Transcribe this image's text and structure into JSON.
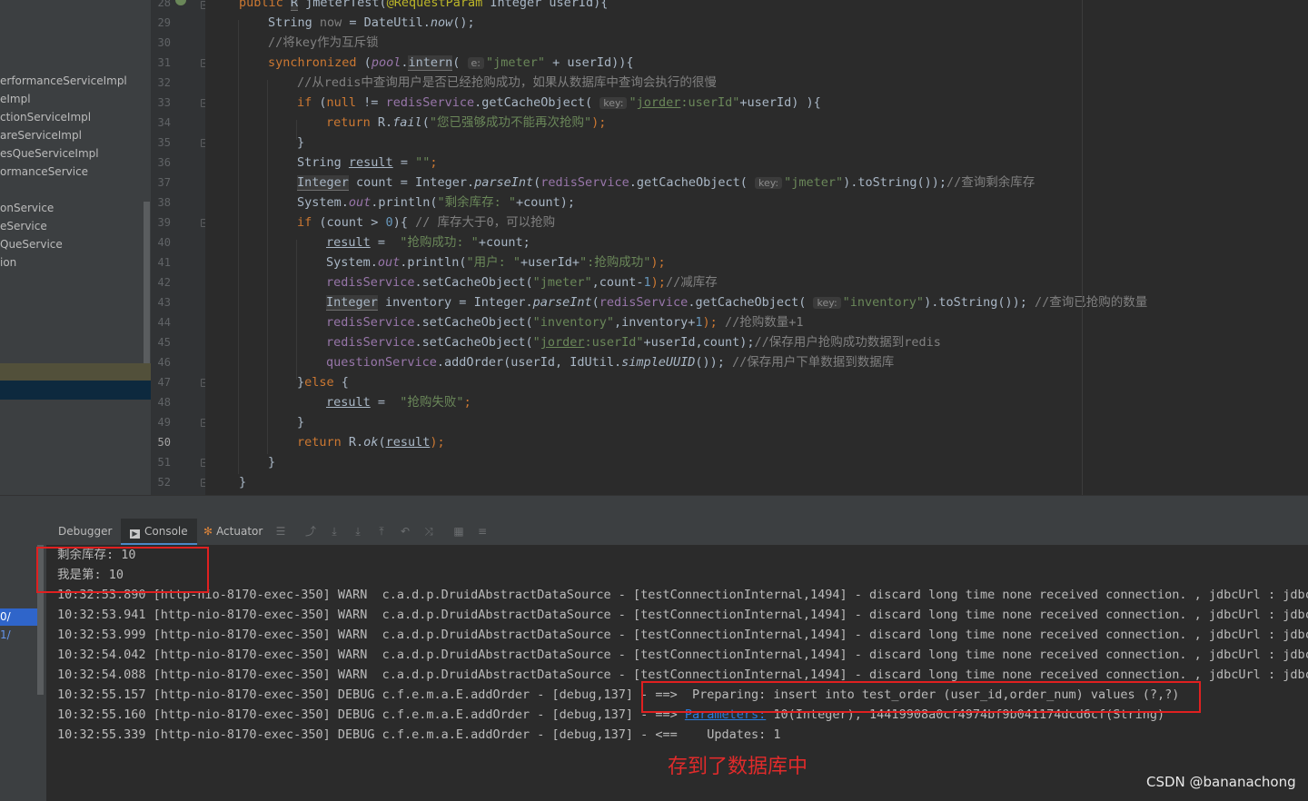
{
  "sidebar": {
    "items": [
      "erformanceServiceImpl",
      "eImpl",
      "ctionServiceImpl",
      "areServiceImpl",
      "esQueServiceImpl",
      "ormanceService",
      "",
      "onService",
      "eService",
      "QueService",
      "ion"
    ]
  },
  "editor": {
    "line_numbers": [
      "28",
      "29",
      "30",
      "31",
      "32",
      "33",
      "34",
      "35",
      "36",
      "37",
      "38",
      "39",
      "40",
      "41",
      "42",
      "43",
      "44",
      "45",
      "46",
      "47",
      "48",
      "49",
      "50",
      "51",
      "52"
    ],
    "current_line": "50",
    "code": {
      "l28": {
        "a": "public ",
        "b": "R",
        "c": " jmeterTest(",
        "d": "@RequestParam",
        "e": " Integer userId){"
      },
      "l29": {
        "a": "String ",
        "b": "now",
        "c": " = DateUtil.",
        "d": "now",
        "e": "();"
      },
      "l30": {
        "a": "//将key作为互斥锁"
      },
      "l31": {
        "a": "synchronized ",
        "b": "(",
        "c": "pool",
        "d": ".",
        "e": "intern",
        "f": "( ",
        "g": "e:",
        "h": "\"jmeter\"",
        "i": " + userId)){"
      },
      "l32": {
        "a": "//从redis中查询用户是否已经抢购成功，如果从数据库中查询会执行的很慢"
      },
      "l33": {
        "a": "if ",
        "b": "(",
        "c": "null",
        "d": " != ",
        "e": "redisService",
        "f": ".getCacheObject( ",
        "g": "key:",
        "h": "\"",
        "i": "jorder",
        "j": ":userId\"",
        "k": "+userId) ){"
      },
      "l34": {
        "a": "return ",
        "b": "R.",
        "c": "fail",
        "d": "(",
        "e": "\"您已强够成功不能再次抢购\"",
        "f": ");"
      },
      "l35": {
        "a": "}"
      },
      "l36": {
        "a": "String ",
        "b": "result",
        "c": " = ",
        "d": "\"\"",
        "e": ";"
      },
      "l37": {
        "a": "Integer",
        "b": " count = Integer.",
        "c": "parseInt",
        "d": "(",
        "e": "redisService",
        "f": ".getCacheObject( ",
        "g": "key:",
        "h": "\"jmeter\"",
        "i": ").toString());",
        "j": "//查询剩余库存"
      },
      "l38": {
        "a": "System.",
        "b": "out",
        "c": ".println(",
        "d": "\"剩余库存: \"",
        "e": "+count);"
      },
      "l39": {
        "a": "if ",
        "b": "(count > ",
        "c": "0",
        "d": "){ ",
        "e": "// 库存大于0，可以抢购"
      },
      "l40": {
        "a": "result",
        "b": " =  ",
        "c": "\"抢购成功: \"",
        "d": "+count;"
      },
      "l41": {
        "a": "System.",
        "b": "out",
        "c": ".println(",
        "d": "\"用户: \"",
        "e": "+userId+",
        "f": "\":抢购成功\"",
        "g": ");"
      },
      "l42": {
        "a": "redisService",
        "b": ".setCacheObject(",
        "c": "\"jmeter\"",
        "d": ",count-",
        "e": "1",
        "f": ");",
        "g": "//减库存"
      },
      "l43": {
        "a": "Integer",
        "b": " inventory = Integer.",
        "c": "parseInt",
        "d": "(",
        "e": "redisService",
        "f": ".getCacheObject( ",
        "g": "key:",
        "h": "\"inventory\"",
        "i": ").toString()); ",
        "j": "//查询已抢购的数量"
      },
      "l44": {
        "a": "redisService",
        "b": ".setCacheObject(",
        "c": "\"inventory\"",
        "d": ",inventory+",
        "e": "1",
        "f": "); ",
        "g": "//抢购数量+1"
      },
      "l45": {
        "a": "redisService",
        "b": ".setCacheObject(",
        "c": "\"",
        "d": "jorder",
        "e": ":userId\"",
        "f": "+userId,count);",
        "g": "//保存用户抢购成功数据到redis"
      },
      "l46": {
        "a": "questionService",
        "b": ".addOrder(userId, IdUtil.",
        "c": "simpleUUID",
        "d": "()); ",
        "e": "//保存用户下单数据到数据库"
      },
      "l47": {
        "a": "}",
        "b": "else ",
        "c": "{"
      },
      "l48": {
        "a": "result",
        "b": " =  ",
        "c": "\"抢购失败\"",
        "d": ";"
      },
      "l49": {
        "a": "}"
      },
      "l50": {
        "a": "return ",
        "b": "R.",
        "c": "ok",
        "d": "(",
        "e": "result",
        "f": ");"
      },
      "l51": {
        "a": "}"
      },
      "l52": {
        "a": "}"
      }
    }
  },
  "toolwindow": {
    "tabs": {
      "debugger": "Debugger",
      "console": "Console",
      "actuator": "Actuator"
    },
    "left_strip": [
      "0/",
      "1/"
    ]
  },
  "console": {
    "lines": [
      "剩余库存: 10",
      "我是第: 10",
      "10:32:53.890 [http-nio-8170-exec-350] WARN  c.a.d.p.DruidAbstractDataSource - [testConnectionInternal,1494] - discard long time none received connection. , jdbcUrl : jdbc:m",
      "10:32:53.941 [http-nio-8170-exec-350] WARN  c.a.d.p.DruidAbstractDataSource - [testConnectionInternal,1494] - discard long time none received connection. , jdbcUrl : jdbc:m",
      "10:32:53.999 [http-nio-8170-exec-350] WARN  c.a.d.p.DruidAbstractDataSource - [testConnectionInternal,1494] - discard long time none received connection. , jdbcUrl : jdbc:m",
      "10:32:54.042 [http-nio-8170-exec-350] WARN  c.a.d.p.DruidAbstractDataSource - [testConnectionInternal,1494] - discard long time none received connection. , jdbcUrl : jdbc:m",
      "10:32:54.088 [http-nio-8170-exec-350] WARN  c.a.d.p.DruidAbstractDataSource - [testConnectionInternal,1494] - discard long time none received connection. , jdbcUrl : jdbc:m",
      "10:32:55.157 [http-nio-8170-exec-350] DEBUG c.f.e.m.a.E.addOrder - [debug,137] - ==>  Preparing: insert into test_order (user_id,order_num) values (?,?)"
    ],
    "line9": {
      "a": "10:32:55.160 [http-nio-8170-exec-350] DEBUG c.f.e.m.a.E.addOrder - [debug,137] - ==> ",
      "link": "Parameters:",
      "b": " 10(Integer), 14419908a0cf4974bf9b041174dcd6cf(String)"
    },
    "line10": "10:32:55.339 [http-nio-8170-exec-350] DEBUG c.f.e.m.a.E.addOrder - [debug,137] - <==    Updates: 1"
  },
  "annotation": "存到了数据库中",
  "watermark": "CSDN @bananachong",
  "colors": {
    "keyword": "#cc7832",
    "string": "#6a8759",
    "comment": "#808080",
    "field": "#9876aa",
    "number": "#6897bb",
    "annotation_red": "#e02020"
  }
}
